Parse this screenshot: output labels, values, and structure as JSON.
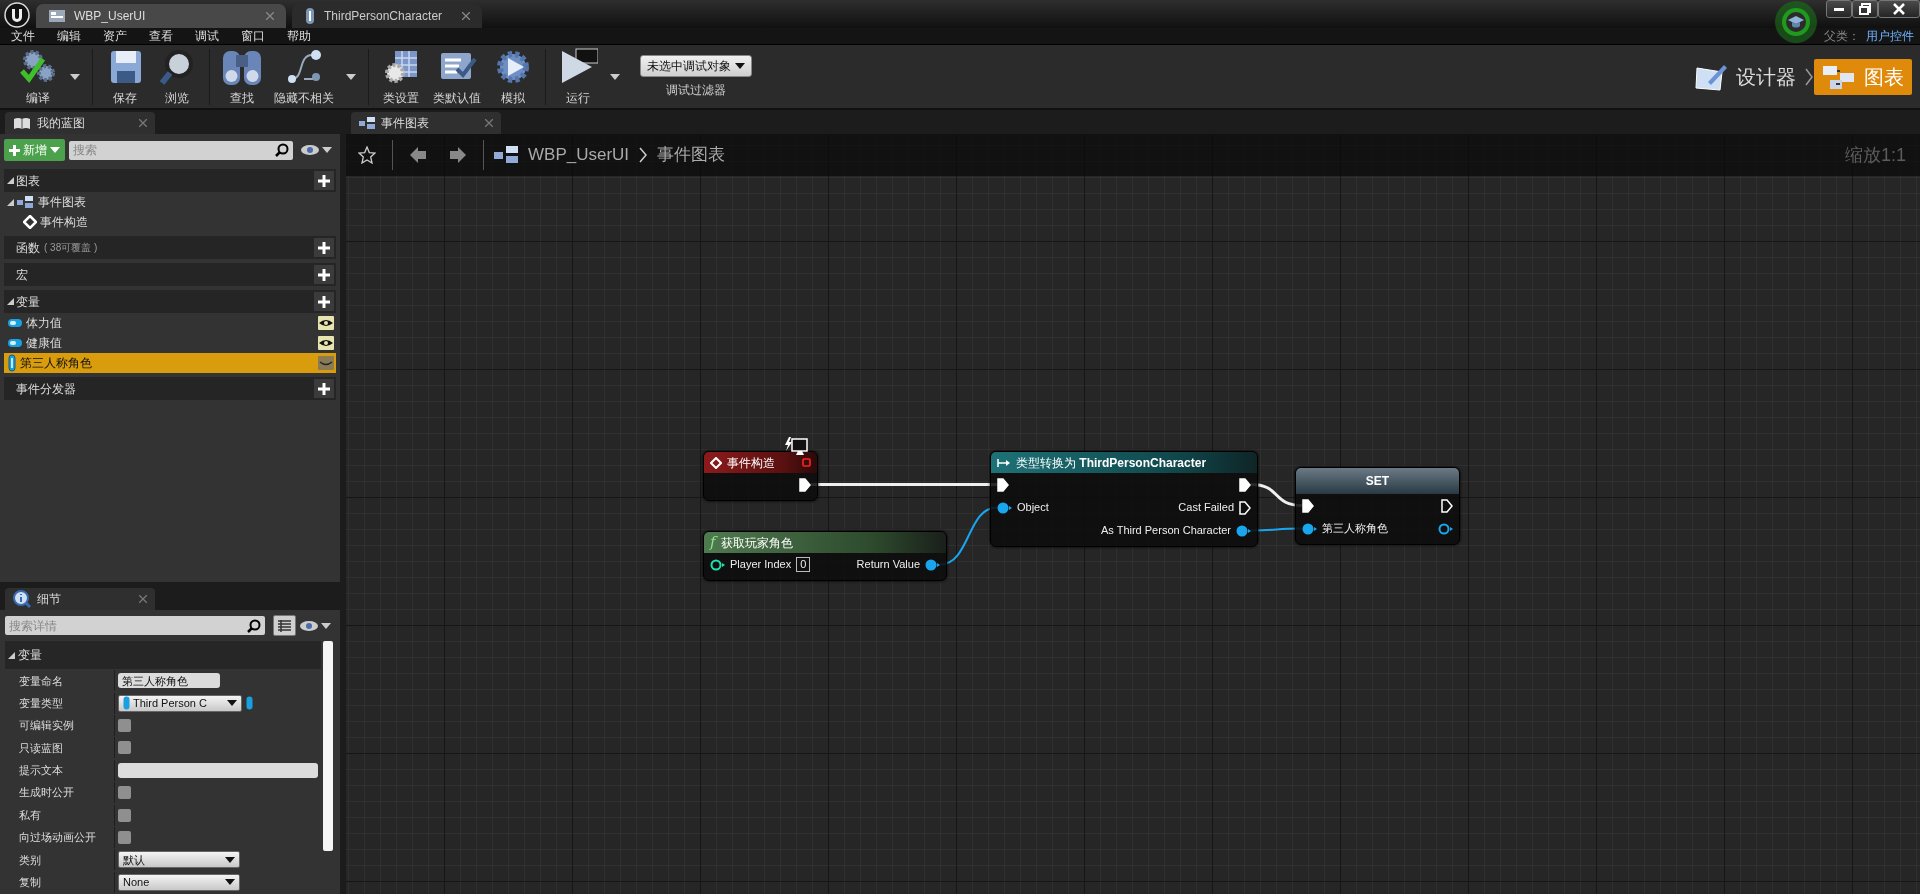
{
  "editor_tabs": [
    {
      "label": "WBP_UserUI",
      "kind": "widget",
      "selected": true
    },
    {
      "label": "ThirdPersonCharacter",
      "kind": "character",
      "selected": false
    }
  ],
  "menu": [
    "文件",
    "编辑",
    "资产",
    "查看",
    "调试",
    "窗口",
    "帮助"
  ],
  "parent_class": {
    "label": "父类：",
    "value": "用户控件"
  },
  "toolbar_groups": [
    {
      "buttons": [
        {
          "label": "编译",
          "kind": "compile",
          "dropdown": true
        }
      ]
    },
    {
      "buttons": [
        {
          "label": "保存",
          "kind": "save",
          "dropdown": false
        },
        {
          "label": "浏览",
          "kind": "browse",
          "dropdown": false
        }
      ]
    },
    {
      "buttons": [
        {
          "label": "查找",
          "kind": "find",
          "dropdown": false
        },
        {
          "label": "隐藏不相关",
          "kind": "hide",
          "dropdown": true
        }
      ]
    },
    {
      "buttons": [
        {
          "label": "类设置",
          "kind": "class_settings",
          "dropdown": false
        },
        {
          "label": "类默认值",
          "kind": "class_defaults",
          "dropdown": false
        },
        {
          "label": "模拟",
          "kind": "simulate",
          "dropdown": false
        }
      ]
    },
    {
      "buttons": [
        {
          "label": "运行",
          "kind": "play",
          "dropdown": true
        }
      ]
    }
  ],
  "debug_filter": {
    "value": "未选中调试对象",
    "label": "调试过滤器"
  },
  "modes": [
    {
      "label": "设计器",
      "kind": "designer",
      "selected": false
    },
    {
      "label": "图表",
      "kind": "graph",
      "selected": true
    }
  ],
  "my_blueprint": {
    "tab": "我的蓝图",
    "add_button": "新增",
    "search_placeholder": "搜索",
    "sections": [
      {
        "title": "图表",
        "expanded": true,
        "items": [
          {
            "label": "事件图表",
            "kind": "graph",
            "expanded": true,
            "selected": false,
            "children": [
              {
                "label": "事件构造",
                "kind": "event",
                "selected": false
              }
            ]
          }
        ]
      },
      {
        "title": "函数",
        "note": "( 38可覆盖 )",
        "expanded": false
      },
      {
        "title": "宏",
        "expanded": false
      },
      {
        "title": "变量",
        "expanded": true,
        "items": [
          {
            "label": "体力值",
            "kind": "float",
            "visible": true,
            "selected": false
          },
          {
            "label": "健康值",
            "kind": "float",
            "visible": true,
            "selected": false
          },
          {
            "label": "第三人称角色",
            "kind": "object",
            "visible": false,
            "selected": true
          }
        ]
      },
      {
        "title": "事件分发器",
        "expanded": false
      }
    ]
  },
  "details": {
    "tab": "细节",
    "search_placeholder": "搜索详情",
    "category": "变量",
    "rows": [
      {
        "label": "变量命名",
        "kind": "text",
        "value": "第三人称角色"
      },
      {
        "label": "变量类型",
        "kind": "type",
        "value": "Third Person C"
      },
      {
        "label": "可编辑实例",
        "kind": "checkbox",
        "checked": false
      },
      {
        "label": "只读蓝图",
        "kind": "checkbox",
        "checked": false
      },
      {
        "label": "提示文本",
        "kind": "text"
      },
      {
        "label": "生成时公开",
        "kind": "checkbox",
        "checked": false
      },
      {
        "label": "私有",
        "kind": "checkbox",
        "checked": false
      },
      {
        "label": "向过场动画公开",
        "kind": "checkbox",
        "checked": false
      },
      {
        "label": "类别",
        "kind": "select",
        "value": "默认"
      },
      {
        "label": "复制",
        "kind": "select",
        "value": "None"
      }
    ]
  },
  "graph": {
    "tab": "事件图表",
    "breadcrumb": [
      "WBP_UserUI",
      "事件图表"
    ],
    "zoom": "缩放1:1",
    "nodes": [
      {
        "kind": "event",
        "title": "事件构造",
        "rows": [
          {
            "out": {
              "kind": "exec",
              "connected": true
            }
          }
        ]
      },
      {
        "kind": "function",
        "glyph": "f",
        "title": "获取玩家角色",
        "rows": [
          {
            "in": {
              "kind": "int",
              "label": "Player Index",
              "value": "0",
              "connected": false
            },
            "out": {
              "kind": "object",
              "label": "Return Value",
              "connected": true
            }
          }
        ]
      },
      {
        "kind": "cast",
        "title": "类型转换为 **ThirdPersonCharacter**",
        "rows": [
          {
            "in": {
              "kind": "exec",
              "connected": true
            },
            "out": {
              "kind": "exec",
              "connected": true
            }
          },
          {
            "in": {
              "kind": "object",
              "label": "Object",
              "connected": true
            },
            "out": {
              "kind": "exec",
              "label": "Cast Failed",
              "connected": false
            }
          },
          {
            "out": {
              "kind": "object",
              "label": "As Third Person Character",
              "connected": true
            }
          }
        ]
      },
      {
        "kind": "set",
        "title": "SET",
        "rows": [
          {
            "in": {
              "kind": "exec",
              "connected": true
            },
            "out": {
              "kind": "exec",
              "connected": false
            }
          },
          {
            "in": {
              "kind": "object",
              "label": "第三人称角色",
              "connected": true
            },
            "out": {
              "kind": "object",
              "connected": false
            }
          }
        ]
      }
    ]
  }
}
